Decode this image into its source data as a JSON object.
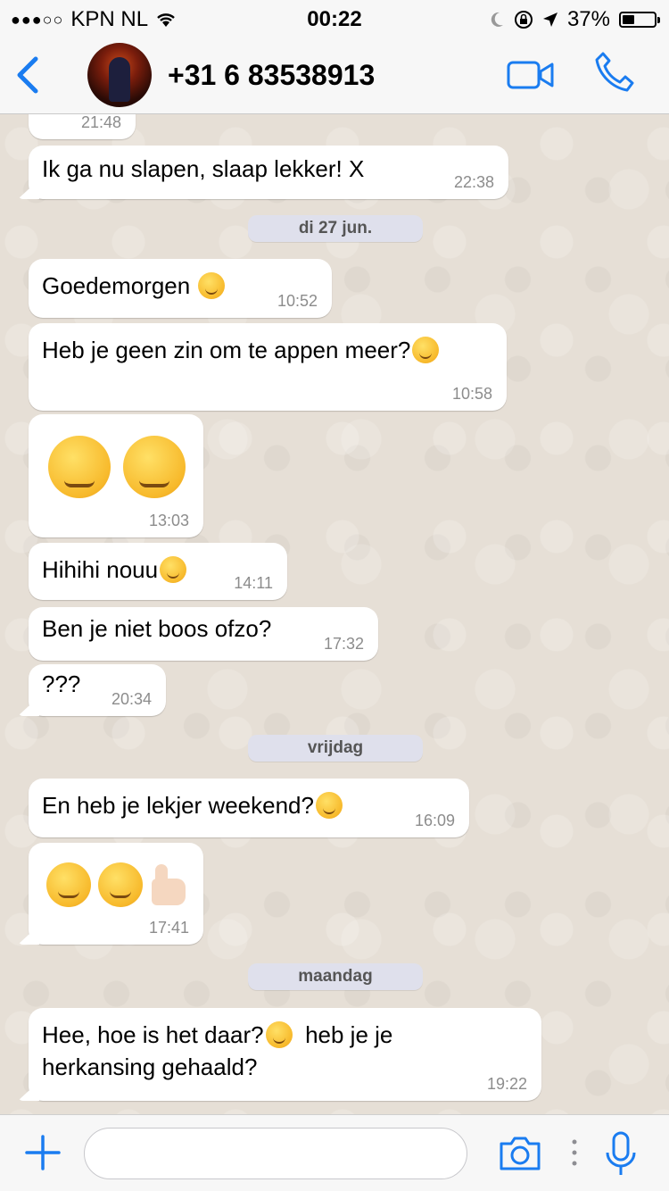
{
  "status_bar": {
    "carrier": "KPN NL",
    "time": "00:22",
    "battery": "37%",
    "battery_level": 0.37
  },
  "header": {
    "contact": "+31 6 83538913",
    "icons": [
      "back-chevron",
      "avatar",
      "video-call",
      "phone"
    ]
  },
  "colors": {
    "accent": "#1a7cf0",
    "bubble": "#ffffff",
    "chat_bg": "#e6dfd6",
    "date_pill": "#dfe0ec",
    "time_text": "#8c8c8c"
  },
  "messages": [
    {
      "text": "",
      "time": "21:48"
    },
    {
      "text": "Ik ga nu slapen, slaap lekker! X",
      "time": "22:38"
    },
    {
      "date": "di 27 jun."
    },
    {
      "text": "Goedemorgen",
      "emoji": "smiling-face",
      "time": "10:52"
    },
    {
      "text": "Heb je geen zin om te appen meer?",
      "emoji": "winking-tongue-face",
      "time": "10:58"
    },
    {
      "emoji": [
        "squinting-tongue-face",
        "squinting-tongue-face"
      ],
      "time": "13:03"
    },
    {
      "text": "Hihihi nouu",
      "emoji": "smiling-face",
      "time": "14:11"
    },
    {
      "text": "Ben je niet boos ofzo?",
      "time": "17:32"
    },
    {
      "text": "???",
      "time": "20:34"
    },
    {
      "date": "vrijdag"
    },
    {
      "text": "En heb je lekjer weekend?",
      "emoji": "winking-face",
      "time": "16:09"
    },
    {
      "emoji": [
        "smiling-face",
        "smiling-face",
        "thumbs-up"
      ],
      "time": "17:41"
    },
    {
      "date": "maandag"
    },
    {
      "text_line1": "Hee, hoe is het daar?",
      "emoji": "grinning-face",
      "text_line1b": "heb je je",
      "text_line2": "herkansing gehaald?",
      "time": "19:22"
    }
  ],
  "input_bar": {
    "placeholder": "",
    "icons": [
      "plus",
      "camera",
      "more",
      "microphone"
    ]
  }
}
